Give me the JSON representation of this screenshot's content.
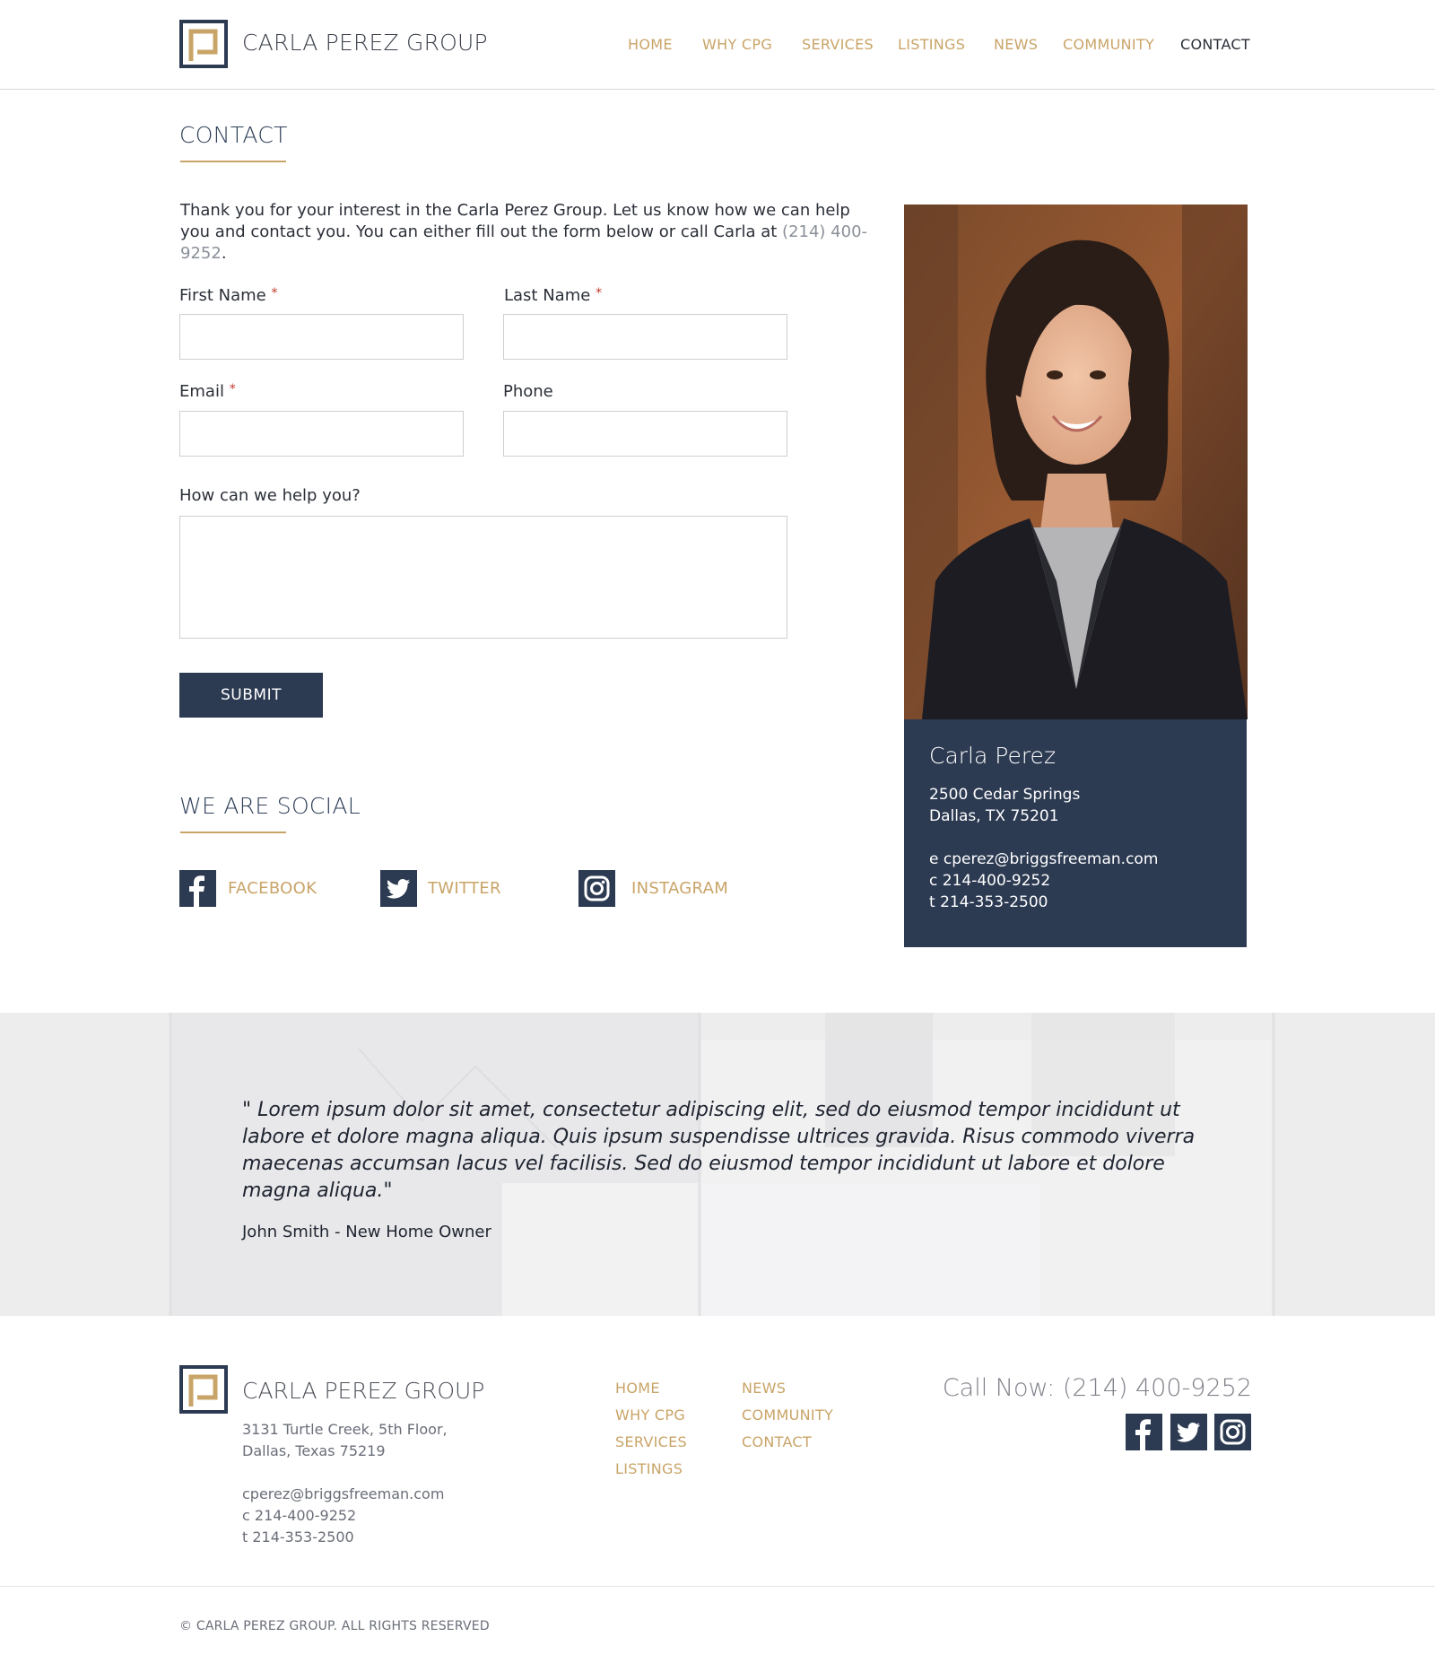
{
  "header": {
    "brand": "CARLA PEREZ GROUP",
    "nav": [
      "HOME",
      "WHY CPG",
      "SERVICES",
      "LISTINGS",
      "NEWS",
      "COMMUNITY",
      "CONTACT"
    ],
    "active": "CONTACT"
  },
  "contact": {
    "title": "CONTACT",
    "intro_text": "Thank you for your interest in the Carla Perez Group.  Let us know how we can help you and contact you. You can either fill out the form below or call Carla at ",
    "intro_phone": "(214) 400-9252",
    "intro_end": ".",
    "form": {
      "first_name": "First Name",
      "last_name": "Last Name",
      "email": "Email",
      "phone": "Phone",
      "message": "How can we help you?",
      "required_mark": "*",
      "submit": "SUBMIT"
    }
  },
  "social": {
    "title": "WE ARE SOCIAL",
    "items": [
      "FACEBOOK",
      "TWITTER",
      "INSTAGRAM"
    ]
  },
  "profile": {
    "name": "Carla Perez",
    "address1": "2500 Cedar Springs",
    "address2": "Dallas, TX 75201",
    "email": "e cperez@briggsfreeman.com",
    "cell": "c 214-400-9252",
    "tel": "t 214-353-2500"
  },
  "testimonial": {
    "quote": "\" Lorem ipsum dolor sit amet, consectetur adipiscing elit, sed do eiusmod tempor incididunt ut labore et dolore magna aliqua. Quis ipsum suspendisse ultrices gravida. Risus commodo viverra maecenas accumsan lacus vel facilisis. Sed do eiusmod tempor incididunt ut labore et dolore magna aliqua.\"",
    "author": "John Smith - New Home Owner"
  },
  "footer": {
    "brand": "CARLA PEREZ GROUP",
    "address1": "3131 Turtle Creek, 5th Floor,",
    "address2": "Dallas, Texas  75219",
    "email": "cperez@briggsfreeman.com",
    "cell": "c 214-400-9252",
    "tel": "t 214-353-2500",
    "links_col1": [
      "HOME",
      "WHY CPG",
      "SERVICES",
      "LISTINGS"
    ],
    "links_col2": [
      "NEWS",
      "COMMUNITY",
      "CONTACT"
    ],
    "call": "Call Now: (214) 400-9252",
    "copyright": "© CARLA PEREZ GROUP. ALL RIGHTS RESERVED"
  },
  "colors": {
    "accent_gold": "#c9a468",
    "navy": "#2c3a52"
  },
  "icons": [
    "logo-icon",
    "facebook-icon",
    "twitter-icon",
    "instagram-icon"
  ]
}
